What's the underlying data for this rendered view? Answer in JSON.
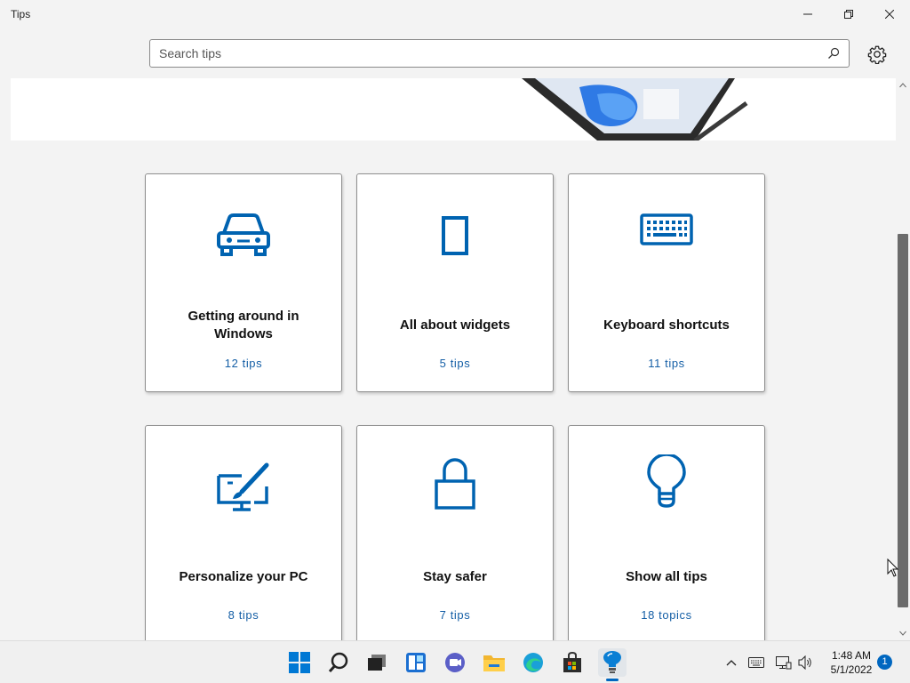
{
  "window": {
    "title": "Tips"
  },
  "search": {
    "placeholder": "Search tips"
  },
  "cards": [
    {
      "title": "Getting around in Windows",
      "count": "12 tips",
      "icon": "car-icon"
    },
    {
      "title": "All about widgets",
      "count": "5 tips",
      "icon": "widget-icon"
    },
    {
      "title": "Keyboard shortcuts",
      "count": "11 tips",
      "icon": "keyboard-icon"
    },
    {
      "title": "Personalize your PC",
      "count": "8 tips",
      "icon": "paintbrush-monitor-icon"
    },
    {
      "title": "Stay safer",
      "count": "7 tips",
      "icon": "lock-icon"
    },
    {
      "title": "Show all tips",
      "count": "18 topics",
      "icon": "lightbulb-icon"
    }
  ],
  "taskbar": {
    "apps": [
      "start",
      "search",
      "task-view",
      "widgets",
      "chat",
      "file-explorer",
      "edge",
      "store",
      "tips"
    ],
    "active_app": "tips"
  },
  "clock": {
    "time": "1:48 AM",
    "date": "5/1/2022"
  },
  "notifications": {
    "count": "1"
  },
  "colors": {
    "accent": "#0067c0",
    "icon_blue": "#0063b1",
    "link": "#155fa6"
  }
}
